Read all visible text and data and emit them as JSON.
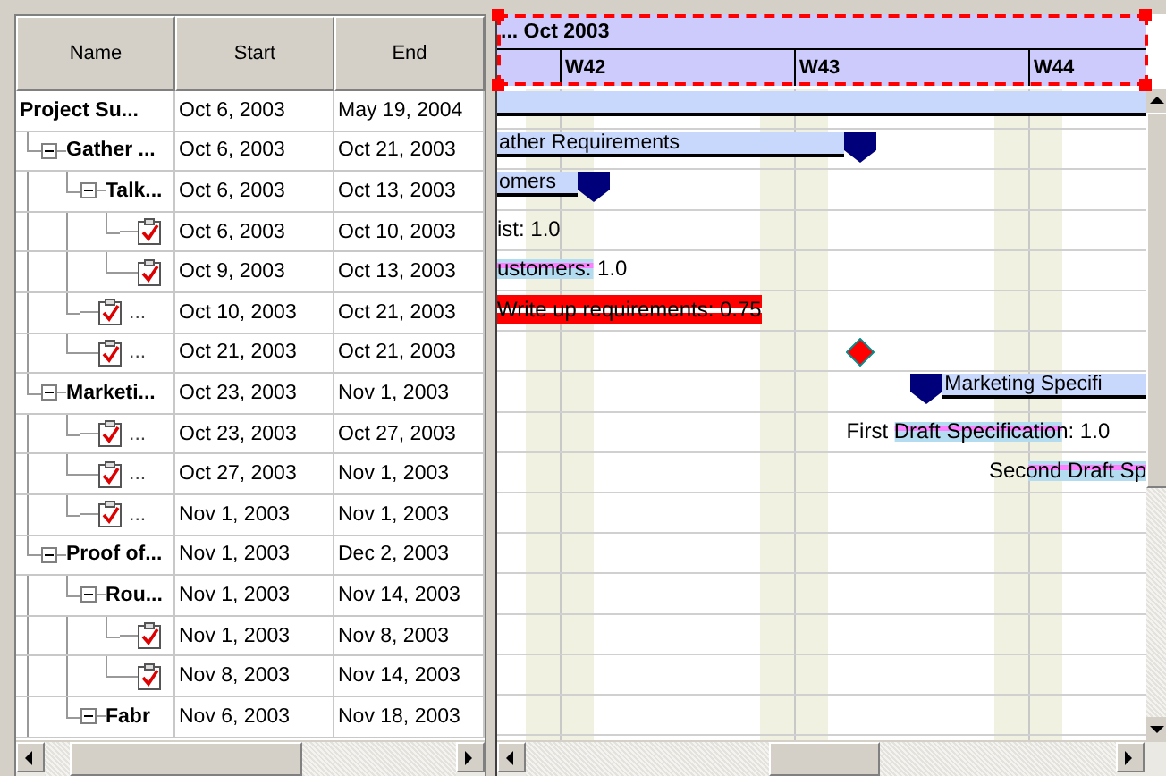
{
  "table": {
    "columns": [
      "Name",
      "Start",
      "End"
    ],
    "rows": [
      {
        "kind": "summary",
        "name": "Project Su...",
        "start": "Oct 6, 2003",
        "end": "May 19, 2004",
        "children": [
          {
            "kind": "summary",
            "name": "Gather ...",
            "start": "Oct 6, 2003",
            "end": "Oct 21, 2003",
            "expanded": true,
            "bar_label": "ather Requirements",
            "children": [
              {
                "kind": "summary",
                "name": "Talk...",
                "start": "Oct 6, 2003",
                "end": "Oct 13, 2003",
                "expanded": true,
                "bar_label": "omers",
                "children": [
                  {
                    "kind": "task",
                    "start": "Oct 6, 2003",
                    "end": "Oct 10, 2003",
                    "bar_label": "ist: 1.0"
                  },
                  {
                    "kind": "task",
                    "start": "Oct 9, 2003",
                    "end": "Oct 13, 2003",
                    "bar_label": "ustomers: 1.0",
                    "critical": false
                  }
                ]
              },
              {
                "kind": "task",
                "name": "...",
                "start": "Oct 10, 2003",
                "end": "Oct 21, 2003",
                "bar_label": "Write up requirements: 0.75",
                "critical": true
              },
              {
                "kind": "milestone",
                "name": "...",
                "start": "Oct 21, 2003",
                "end": "Oct 21, 2003",
                "critical": true
              }
            ]
          },
          {
            "kind": "summary",
            "name": "Marketi...",
            "start": "Oct 23, 2003",
            "end": "Nov 1, 2003",
            "expanded": true,
            "bar_label": "Marketing Specifi",
            "children": [
              {
                "kind": "task",
                "name": "...",
                "start": "Oct 23, 2003",
                "end": "Oct 27, 2003",
                "bar_label": "First Draft Specification: 1.0",
                "critical": false
              },
              {
                "kind": "task",
                "name": "...",
                "start": "Oct 27, 2003",
                "end": "Nov 1, 2003",
                "bar_label": "Second Draft Sp",
                "critical": false
              },
              {
                "kind": "milestone",
                "name": "...",
                "start": "Nov 1, 2003",
                "end": "Nov 1, 2003"
              }
            ]
          },
          {
            "kind": "summary",
            "name": "Proof of...",
            "start": "Nov 1, 2003",
            "end": "Dec 2, 2003",
            "expanded": true,
            "children": [
              {
                "kind": "summary",
                "name": "Rou...",
                "start": "Nov 1, 2003",
                "end": "Nov 14, 2003",
                "expanded": true,
                "children": [
                  {
                    "kind": "task",
                    "start": "Nov 1, 2003",
                    "end": "Nov 8, 2003"
                  },
                  {
                    "kind": "task",
                    "start": "Nov 8, 2003",
                    "end": "Nov 14, 2003"
                  }
                ]
              },
              {
                "kind": "summary",
                "name": "Fabr",
                "start": "Nov 6, 2003",
                "end": "Nov 18, 2003",
                "expanded": true
              }
            ]
          }
        ]
      }
    ]
  },
  "timeline": {
    "month": "... Oct 2003",
    "weeks": [
      "W42",
      "W43",
      "W44"
    ],
    "selected": true
  }
}
